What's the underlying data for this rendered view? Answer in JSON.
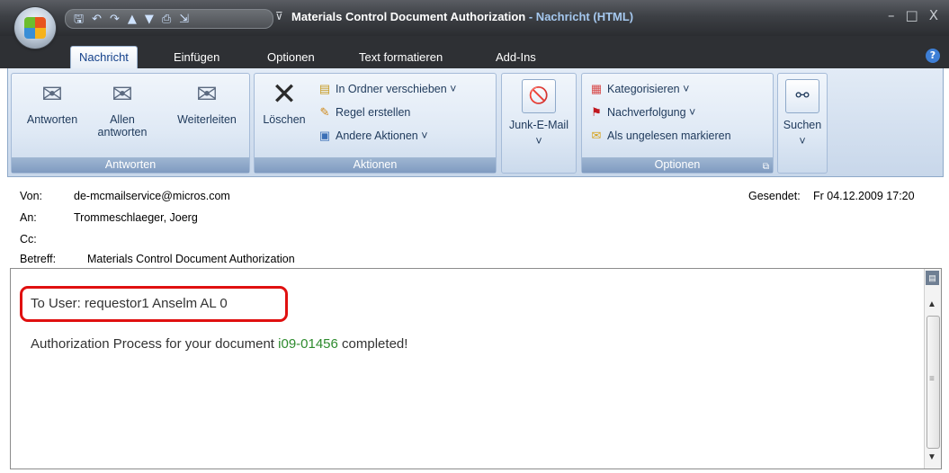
{
  "window": {
    "title": "Materials Control Document Authorization",
    "app_suffix": " - Nachricht (HTML)",
    "controls": [
      "–",
      "□",
      "X"
    ]
  },
  "qat": {
    "icons": [
      "save-icon",
      "undo-icon",
      "redo-icon",
      "previous-icon",
      "next-icon",
      "print-icon",
      "move-icon"
    ],
    "more": "⊽"
  },
  "tabs": [
    "Nachricht",
    "Einfügen",
    "Optionen",
    "Text formatieren",
    "Add-Ins"
  ],
  "help": "?",
  "ribbon": {
    "respond": {
      "group_label": "Antworten",
      "reply": "Antworten",
      "reply_all_1": "Allen",
      "reply_all_2": "antworten",
      "forward": "Weiterleiten"
    },
    "actions": {
      "group_label": "Aktionen",
      "delete": "Löschen",
      "move_to_folder": "In Ordner verschieben ˅",
      "create_rule": "Regel erstellen",
      "other_actions": "Andere Aktionen ˅"
    },
    "junk": {
      "label": "Junk-E-Mail",
      "caret": "˅"
    },
    "options": {
      "group_label": "Optionen",
      "categorize": "Kategorisieren ˅",
      "follow_up": "Nachverfolgung ˅",
      "mark_unread": "Als ungelesen markieren",
      "launcher": "⧉"
    },
    "find": {
      "label": "Suchen",
      "caret": "˅"
    }
  },
  "header": {
    "from_label": "Von:",
    "from_value": "de-mcmailservice@micros.com",
    "to_label": "An:",
    "to_value": "Trommeschlaeger, Joerg",
    "cc_label": "Cc:",
    "cc_value": "",
    "subject_label": "Betreff:",
    "subject_value": "Materials Control Document Authorization",
    "sent_label": "Gesendet:",
    "sent_value": "Fr 04.12.2009 17:20"
  },
  "message": {
    "line1": "To User: requestor1 Anselm AL 0",
    "line2_prefix": "Authorization Process for your document ",
    "doc_id": "i09-01456",
    "line2_suffix": " completed!"
  },
  "colors": {
    "highlight": "#e01010",
    "doc_link": "#2e8b2e"
  }
}
